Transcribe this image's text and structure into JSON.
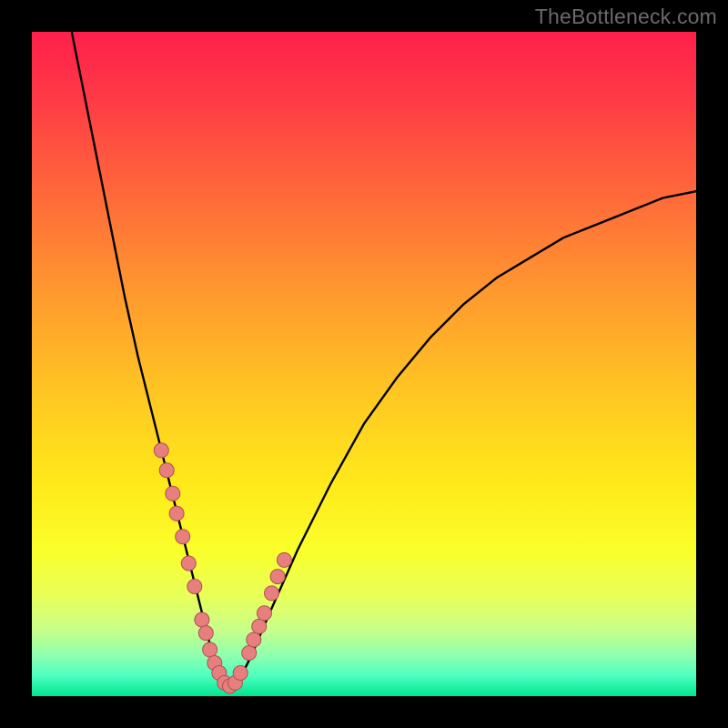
{
  "watermark": "TheBottleneck.com",
  "chart_data": {
    "type": "line",
    "title": "",
    "xlabel": "",
    "ylabel": "",
    "xlim": [
      0,
      100
    ],
    "ylim": [
      0,
      100
    ],
    "series": [
      {
        "name": "bottleneck-curve",
        "x": [
          6,
          8,
          10,
          12,
          14,
          16,
          18,
          20,
          22,
          24,
          26,
          27,
          28,
          29,
          30,
          31,
          33,
          36,
          40,
          45,
          50,
          55,
          60,
          65,
          70,
          75,
          80,
          85,
          90,
          95,
          100
        ],
        "y": [
          100,
          90,
          80,
          70,
          60,
          51,
          43,
          35,
          27,
          19,
          11,
          7,
          4,
          2,
          1,
          2,
          6,
          13,
          22,
          32,
          41,
          48,
          54,
          59,
          63,
          66,
          69,
          71,
          73,
          75,
          76
        ]
      }
    ],
    "markers": {
      "name": "highlight-points",
      "x": [
        19.5,
        20.3,
        21.2,
        21.8,
        22.7,
        23.6,
        24.5,
        25.6,
        26.2,
        26.8,
        27.5,
        28.2,
        29.0,
        29.8,
        30.6,
        31.4,
        32.7,
        33.4,
        34.2,
        35.0,
        36.1,
        37.0,
        38.0
      ],
      "y": [
        37.0,
        34.0,
        30.5,
        27.5,
        24.0,
        20.0,
        16.5,
        11.5,
        9.5,
        7.0,
        5.0,
        3.5,
        2.0,
        1.5,
        2.0,
        3.5,
        6.5,
        8.5,
        10.5,
        12.5,
        15.5,
        18.0,
        20.5
      ]
    },
    "colors": {
      "curve": "#000000",
      "marker_fill": "#e77f7f",
      "marker_stroke": "#b05050",
      "gradient_top": "#ff1f4b",
      "gradient_bottom": "#00e58e"
    }
  }
}
